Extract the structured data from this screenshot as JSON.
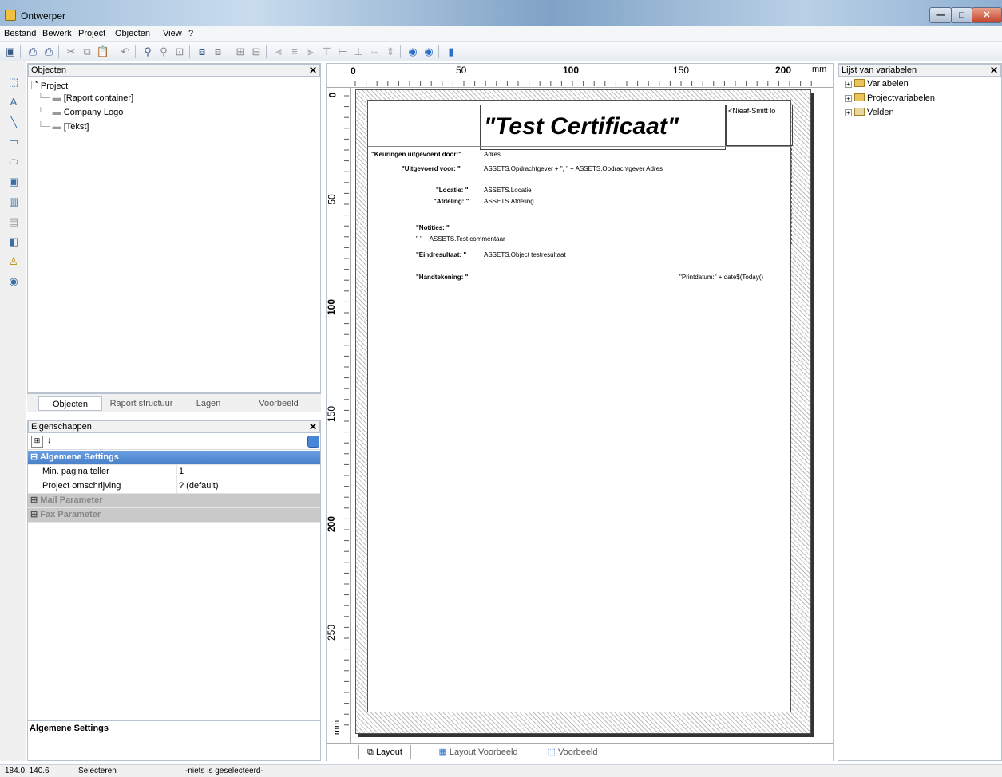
{
  "window": {
    "title": "Ontwerper",
    "min": "—",
    "max": "□",
    "close": "✕"
  },
  "menu": [
    "Bestand",
    "Bewerk",
    "Project",
    "Objecten",
    "View",
    "?"
  ],
  "objects_panel": {
    "title": "Objecten",
    "close": "✕",
    "root": "Project",
    "items": [
      "[Raport container]",
      "Company Logo",
      "[Tekst]"
    ]
  },
  "objects_tabs": [
    "Objecten",
    "Raport structuur",
    "Lagen",
    "Voorbeeld"
  ],
  "properties_panel": {
    "title": "Eigenschappen",
    "close": "✕",
    "sort_az": "↓",
    "group_active": "Algemene Settings",
    "rows": [
      {
        "name": "Min. pagina teller",
        "value": "1"
      },
      {
        "name": "Project omschrijving",
        "value": "? (default)"
      }
    ],
    "groups_collapsed": [
      "Mail Parameter",
      "Fax Parameter"
    ],
    "description_title": "Algemene Settings"
  },
  "ruler": {
    "h_labels": [
      "0",
      "50",
      "100",
      "150",
      "200"
    ],
    "unit": "mm",
    "v_labels": [
      "0",
      "50",
      "100",
      "150",
      "200",
      "250"
    ]
  },
  "report": {
    "title": "\"Test Certificaat\"",
    "logo_text": "<Nieaf-Smitt lo",
    "lines": [
      {
        "label": "\"Keuringen uitgevoerd door:\"",
        "value": "Adres"
      },
      {
        "label": "\"Uitgevoerd voor: \"",
        "value": "ASSETS.Opdrachtgever + \", \" + ASSETS.Opdrachtgever Adres"
      },
      {
        "label": "\"Locatie: \"",
        "value": "ASSETS.Locatie"
      },
      {
        "label": "\"Afdeling: \"",
        "value": "ASSETS.Afdeling"
      },
      {
        "label": "\"Notities: \"",
        "value": ""
      },
      {
        "label": "\"  \" + ASSETS.Test commentaar",
        "value": ""
      },
      {
        "label": "\"Eindresultaat: \"",
        "value": "ASSETS.Object testresultaat"
      },
      {
        "label": "\"Handtekening: \"",
        "value": ""
      }
    ],
    "printdate": "\"Printdatum:\" + date$(Today()"
  },
  "designer_tabs": [
    "Layout",
    "Layout Voorbeeld",
    "Voorbeeld"
  ],
  "variables_panel": {
    "title": "Lijst van variabelen",
    "close": "✕",
    "items": [
      "Variabelen",
      "Projectvariabelen",
      "Velden"
    ]
  },
  "status": {
    "coords": "184.0, 140.6",
    "mode": "Selecteren",
    "selection": "-niets is geselecteerd-"
  }
}
